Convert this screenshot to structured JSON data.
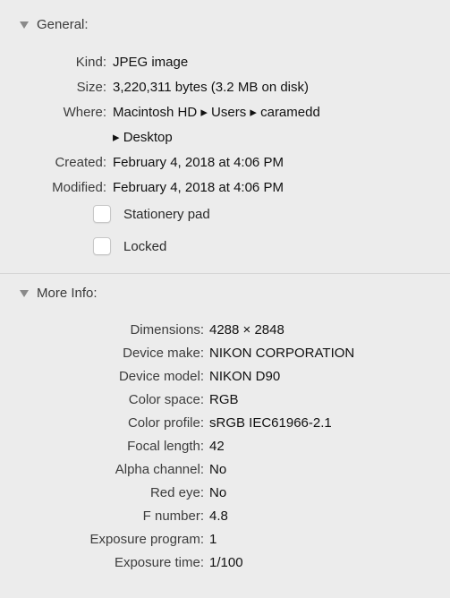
{
  "general": {
    "header": "General:",
    "kind": {
      "label": "Kind:",
      "value": "JPEG image"
    },
    "size": {
      "label": "Size:",
      "value": "3,220,311 bytes (3.2 MB on disk)"
    },
    "where": {
      "label": "Where:",
      "value_line1": "Macintosh HD ▸ Users ▸ caramedd",
      "value_line2": "▸ Desktop"
    },
    "created": {
      "label": "Created:",
      "value": "February 4, 2018 at 4:06 PM"
    },
    "modified": {
      "label": "Modified:",
      "value": "February 4, 2018 at 4:06 PM"
    },
    "stationery": {
      "label": "Stationery pad"
    },
    "locked": {
      "label": "Locked"
    }
  },
  "more_info": {
    "header": "More Info:",
    "rows": [
      {
        "label": "Dimensions:",
        "value": "4288 × 2848"
      },
      {
        "label": "Device make:",
        "value": "NIKON CORPORATION"
      },
      {
        "label": "Device model:",
        "value": "NIKON D90"
      },
      {
        "label": "Color space:",
        "value": "RGB"
      },
      {
        "label": "Color profile:",
        "value": "sRGB IEC61966-2.1"
      },
      {
        "label": "Focal length:",
        "value": "42"
      },
      {
        "label": "Alpha channel:",
        "value": "No"
      },
      {
        "label": "Red eye:",
        "value": "No"
      },
      {
        "label": "F number:",
        "value": "4.8"
      },
      {
        "label": "Exposure program:",
        "value": "1"
      },
      {
        "label": "Exposure time:",
        "value": "1/100"
      }
    ]
  }
}
